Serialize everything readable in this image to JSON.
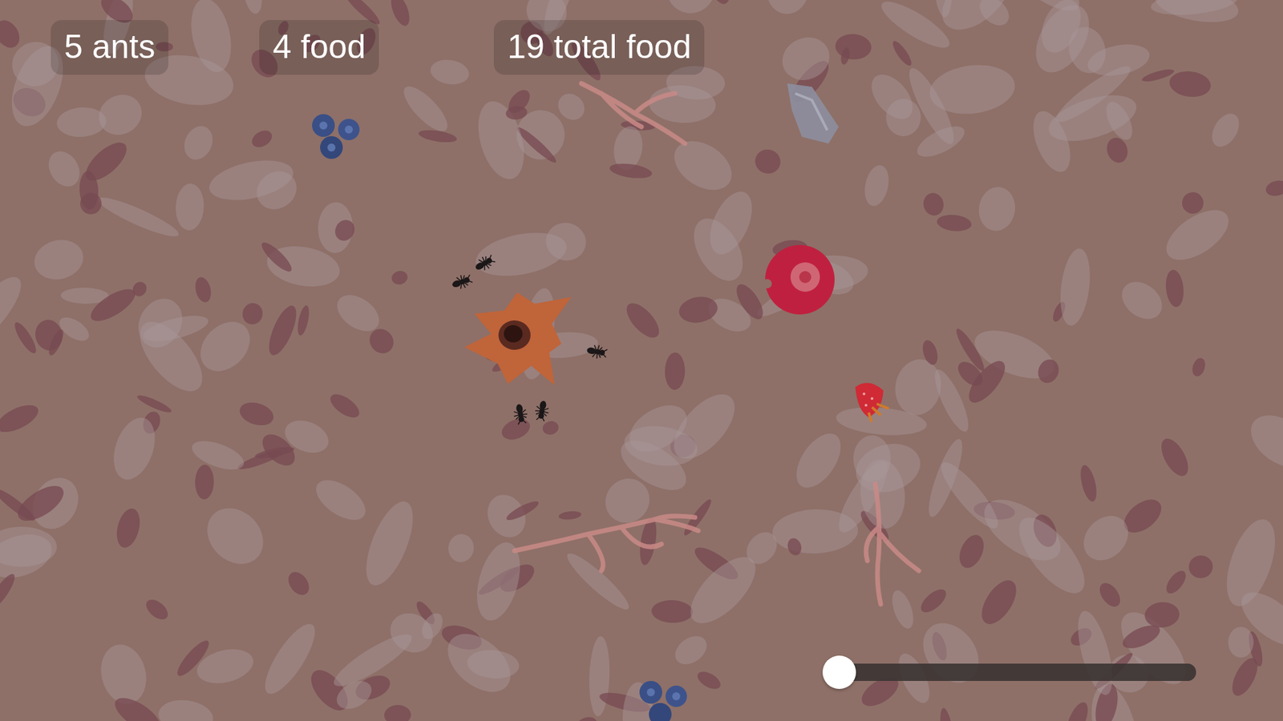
{
  "hud": [
    {
      "label": "5 ants"
    },
    {
      "label": "4 food"
    },
    {
      "label": "19 total food"
    }
  ],
  "speed_slider": {
    "level": 0
  }
}
